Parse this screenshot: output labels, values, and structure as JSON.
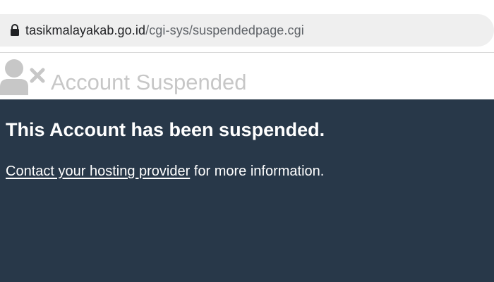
{
  "browser": {
    "url_domain": "tasikmalayakab.go.id",
    "url_path": "/cgi-sys/suspendedpage.cgi",
    "lock_icon": "lock-icon"
  },
  "header": {
    "icon": "user-remove-icon",
    "title": "Account Suspended"
  },
  "main": {
    "headline": "This Account has been suspended.",
    "contact_link": "Contact your hosting provider",
    "message_suffix": " for more information."
  },
  "colors": {
    "main_background": "#283849",
    "header_title": "#c7c7c7",
    "urlbar_background": "#efefef"
  }
}
